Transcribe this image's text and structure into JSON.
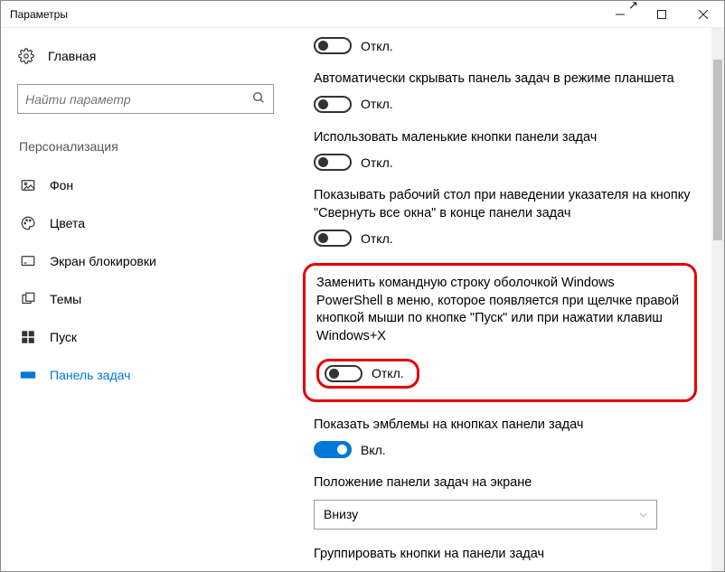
{
  "window": {
    "title": "Параметры"
  },
  "sidebar": {
    "home": "Главная",
    "search_placeholder": "Найти параметр",
    "group": "Персонализация",
    "items": [
      {
        "label": "Фон"
      },
      {
        "label": "Цвета"
      },
      {
        "label": "Экран блокировки"
      },
      {
        "label": "Темы"
      },
      {
        "label": "Пуск"
      },
      {
        "label": "Панель задач"
      }
    ]
  },
  "settings": {
    "s0_state": "Откл.",
    "s1_label": "Автоматически скрывать панель задач в режиме планшета",
    "s1_state": "Откл.",
    "s2_label": "Использовать маленькие кнопки панели задач",
    "s2_state": "Откл.",
    "s3_label": "Показывать рабочий стол при наведении указателя на кнопку \"Свернуть все окна\" в конце панели задач",
    "s3_state": "Откл.",
    "s4_label": "Заменить командную строку оболочкой Windows PowerShell в меню, которое появляется при щелчке правой кнопкой мыши по кнопке \"Пуск\" или при нажатии клавиш Windows+X",
    "s4_state": "Откл.",
    "s5_label": "Показать эмблемы на кнопках панели задач",
    "s5_state": "Вкл.",
    "s6_label": "Положение панели задач на экране",
    "s6_value": "Внизу",
    "s7_label": "Группировать кнопки на панели задач"
  }
}
